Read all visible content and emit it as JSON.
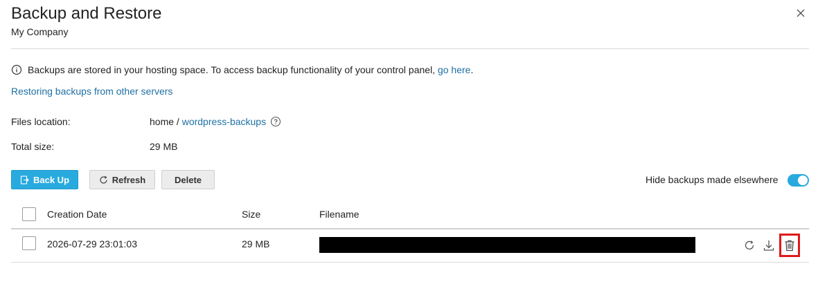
{
  "header": {
    "title": "Backup and Restore",
    "subtitle": "My Company"
  },
  "info": {
    "text": "Backups are stored in your hosting space. To access backup functionality of your control panel, ",
    "link": "go here",
    "trailing": "."
  },
  "restore_link": "Restoring backups from other servers",
  "files_location": {
    "label": "Files location:",
    "root": "home",
    "separator": " / ",
    "folder": "wordpress-backups"
  },
  "total_size": {
    "label": "Total size:",
    "value": "29 MB"
  },
  "toolbar": {
    "backup_label": "Back Up",
    "refresh_label": "Refresh",
    "delete_label": "Delete",
    "hide_toggle_label": "Hide backups made elsewhere",
    "hide_toggle_on": true
  },
  "table": {
    "columns": [
      "Creation Date",
      "Size",
      "Filename"
    ],
    "rows": [
      {
        "date": "2026-07-29 23:01:03",
        "size": "29 MB",
        "filename": ""
      }
    ]
  },
  "colors": {
    "accent": "#28aade",
    "link": "#1e6fa4",
    "highlight": "#e01919"
  }
}
